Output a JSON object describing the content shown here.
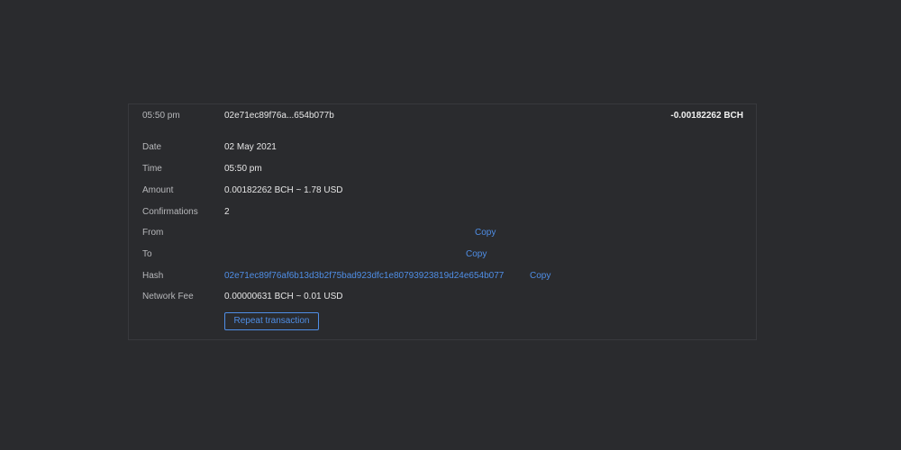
{
  "header": {
    "time": "05:50 pm",
    "hash_short": "02e71ec89f76a...654b077b",
    "amount": "-0.00182262 BCH"
  },
  "details": {
    "date": {
      "label": "Date",
      "value": "02 May 2021"
    },
    "time": {
      "label": "Time",
      "value": "05:50 pm"
    },
    "amount": {
      "label": "Amount",
      "value": "0.00182262 BCH ~ 1.78 USD"
    },
    "confirmations": {
      "label": "Confirmations",
      "value": "2"
    },
    "from": {
      "label": "From",
      "value": "",
      "copy_label": "Copy"
    },
    "to": {
      "label": "To",
      "value": "",
      "copy_label": "Copy"
    },
    "hash": {
      "label": "Hash",
      "value": "02e71ec89f76af6b13d3b2f75bad923dfc1e80793923819d24e654b077b",
      "copy_label": "Copy"
    },
    "network_fee": {
      "label": "Network Fee",
      "value": "0.00000631 BCH ~ 0.01 USD"
    }
  },
  "actions": {
    "repeat_label": "Repeat transaction"
  },
  "colors": {
    "background": "#2a2b2e",
    "link": "#4f8ee6",
    "label": "#b7b8bb",
    "text": "#e6e6e6"
  }
}
